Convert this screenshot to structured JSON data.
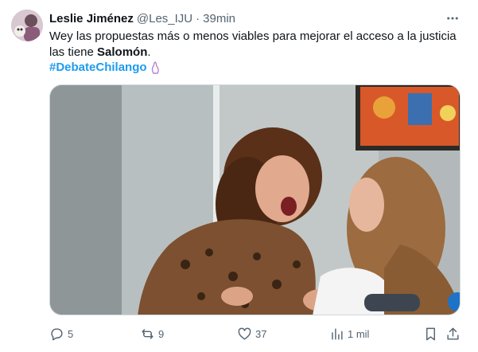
{
  "tweet": {
    "author": {
      "display_name": "Leslie Jiménez",
      "handle": "@Les_IJU",
      "separator": "·",
      "time": "39min"
    },
    "text_part1": "Wey las propuestas más o menos viables para mejorar el acceso a la justicia las tiene ",
    "text_bold": "Salomón",
    "text_part2": ".",
    "hashtag": "#DebateChilango",
    "actions": {
      "replies": "5",
      "retweets": "9",
      "likes": "37",
      "views": "1 mil"
    },
    "icons": {
      "more": "more-horizontal-icon",
      "reply": "reply-icon",
      "retweet": "retweet-icon",
      "like": "heart-icon",
      "views": "views-bar-icon",
      "bookmark": "bookmark-icon",
      "share": "share-icon"
    },
    "colors": {
      "accent": "#1d9bf0",
      "muted": "#536471",
      "text": "#0f1419"
    }
  }
}
